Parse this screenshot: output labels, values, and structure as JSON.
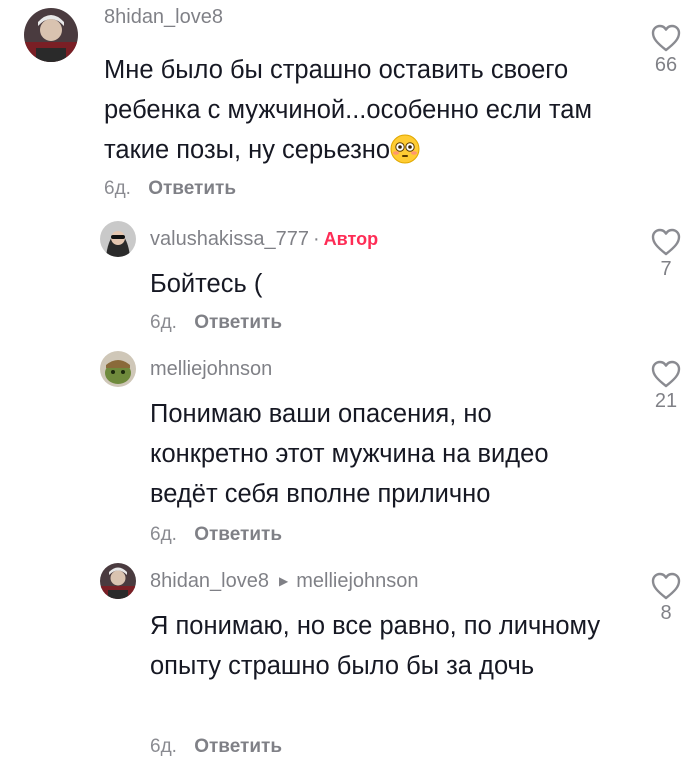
{
  "comments": [
    {
      "username": "8hidan_love8",
      "text": "Мне было бы страшно оставить своего ребенка с мужчиной...особенно если там такие позы, ну серьезно",
      "emoji": "flushed-face-icon",
      "age": "6д.",
      "reply_label": "Ответить",
      "likes": "66"
    },
    {
      "username": "valushakissa_777",
      "dot": "·",
      "author_label": "Автор",
      "text": "Бойтесь (",
      "age": "6д.",
      "reply_label": "Ответить",
      "likes": "7"
    },
    {
      "username": "melliejohnson",
      "text": "Понимаю ваши опасения, но конкретно этот мужчина на видео ведёт себя вполне прилично",
      "age": "6д.",
      "reply_label": "Ответить",
      "likes": "21"
    },
    {
      "username": "8hidan_love8",
      "reply_to": "melliejohnson",
      "text": "Я понимаю, но все равно, по личному опыту страшно было бы за дочь",
      "age": "6д.",
      "reply_label": "Ответить",
      "likes": "8"
    }
  ],
  "colors": {
    "author_tag": "#fe2c55",
    "text": "#161823",
    "muted": "#8a8b91"
  }
}
